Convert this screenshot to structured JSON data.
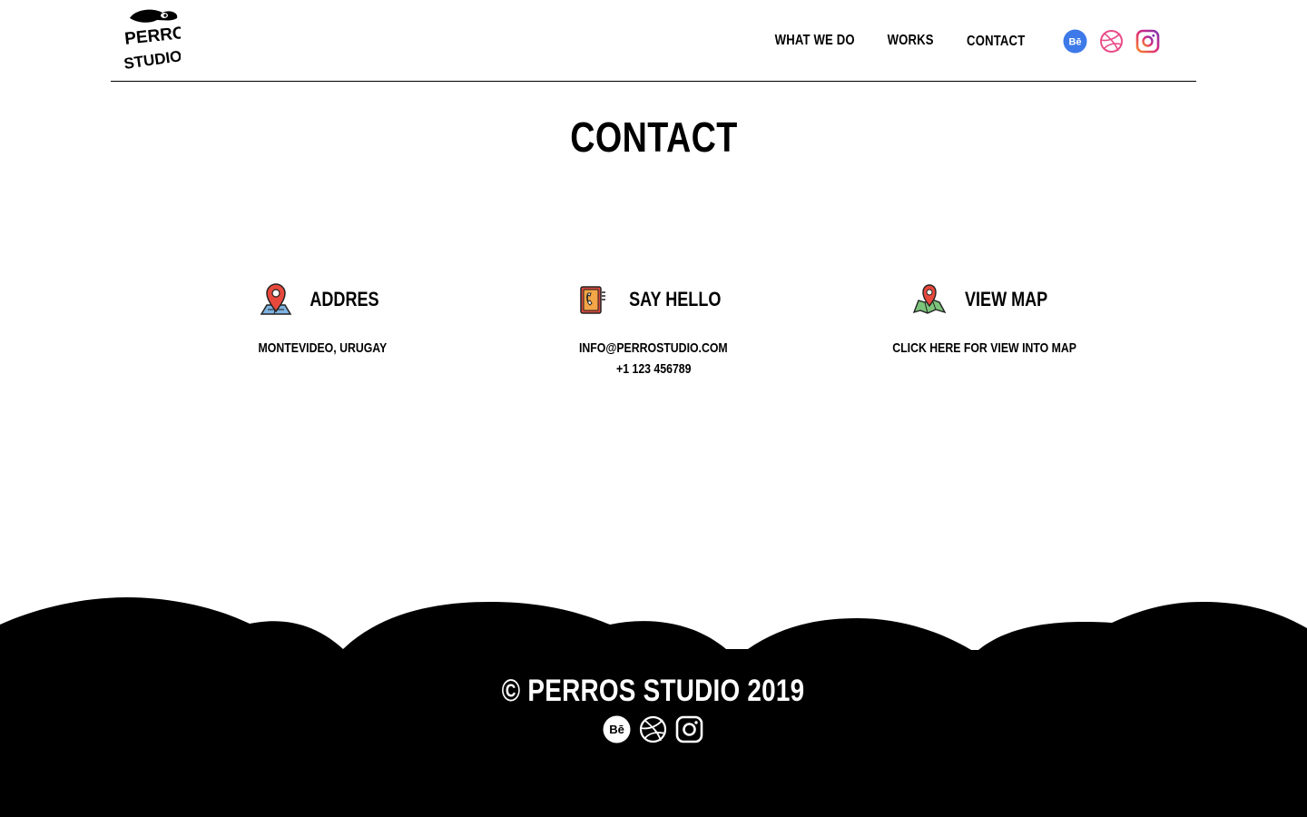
{
  "brand": {
    "logo_text_top": "PERRO",
    "logo_text_bottom": "STUDIO"
  },
  "nav": {
    "items": [
      "WHAT WE DO",
      "WORKS",
      "CONTACT"
    ]
  },
  "social": {
    "behance_label": "Bē",
    "colors": {
      "behance": "#3d79e8",
      "dribbble": "#ea4c89",
      "instagram_start": "#f58529",
      "instagram_end": "#8134af"
    }
  },
  "page": {
    "title": "CONTACT"
  },
  "sections": [
    {
      "icon": "map-pin-icon",
      "label": "ADDRES",
      "lines": [
        "MONTEVIDEO, URUGAY"
      ]
    },
    {
      "icon": "phone-book-icon",
      "label": "SAY HELLO",
      "lines": [
        "INFO@PERROSTUDIO.COM",
        "+1 123 456789"
      ]
    },
    {
      "icon": "map-icon",
      "label": "VIEW MAP",
      "lines": [
        "CLICK HERE FOR VIEW INTO MAP"
      ]
    }
  ],
  "footer": {
    "copyright": "© PERROS STUDIO 2019"
  }
}
